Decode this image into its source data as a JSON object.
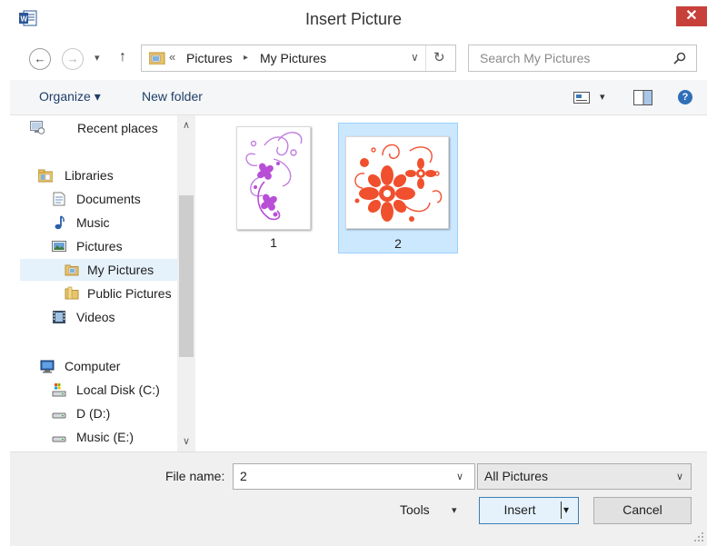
{
  "window": {
    "title": "Insert Picture",
    "close_glyph": "✕",
    "app_icon": "word-icon"
  },
  "nav": {
    "back_glyph": "←",
    "forward_glyph": "→",
    "recent_glyph": "▾",
    "up_glyph": "↑",
    "address": {
      "overflow": "«",
      "crumbs": [
        "Pictures",
        "My Pictures"
      ],
      "separator": "▸",
      "dropdown_glyph": "∨",
      "refresh_glyph": "↻"
    },
    "search": {
      "placeholder": "Search My Pictures"
    }
  },
  "toolbar": {
    "organize_label": "Organize ▾",
    "new_folder_label": "New folder",
    "view_menu_glyph": "▾",
    "help_glyph": "?"
  },
  "sidebar": {
    "items": [
      {
        "label": "Recent places",
        "icon": "recent-places-icon"
      },
      {
        "label": "Libraries",
        "icon": "libraries-icon"
      },
      {
        "label": "Documents",
        "icon": "documents-icon"
      },
      {
        "label": "Music",
        "icon": "music-icon"
      },
      {
        "label": "Pictures",
        "icon": "pictures-icon"
      },
      {
        "label": "My Pictures",
        "icon": "folder-icon",
        "selected": true
      },
      {
        "label": "Public Pictures",
        "icon": "folder-icon"
      },
      {
        "label": "Videos",
        "icon": "videos-icon"
      },
      {
        "label": "Computer",
        "icon": "computer-icon"
      },
      {
        "label": "Local Disk (C:)",
        "icon": "local-disk-icon"
      },
      {
        "label": "D (D:)",
        "icon": "drive-icon"
      },
      {
        "label": "Music (E:)",
        "icon": "drive-icon"
      }
    ],
    "scroll_up_glyph": "∧",
    "scroll_down_glyph": "∨"
  },
  "files": [
    {
      "name": "1",
      "selected": false,
      "art": "purple floral swirl"
    },
    {
      "name": "2",
      "selected": true,
      "art": "red floral ornament"
    }
  ],
  "bottom": {
    "file_name_label": "File name:",
    "file_name_value": "2",
    "file_type_value": "All Pictures",
    "tools_label": "Tools",
    "insert_label": "Insert",
    "cancel_label": "Cancel",
    "dropdown_glyph": "∨",
    "split_glyph": "▾",
    "tools_glyph": "▾"
  },
  "colors": {
    "accent": "#3c7fb1",
    "close": "#c8403a",
    "selection": "#cce8ff",
    "art1": "#b84fd6",
    "art2": "#f0502e",
    "link": "#1f3e69"
  }
}
